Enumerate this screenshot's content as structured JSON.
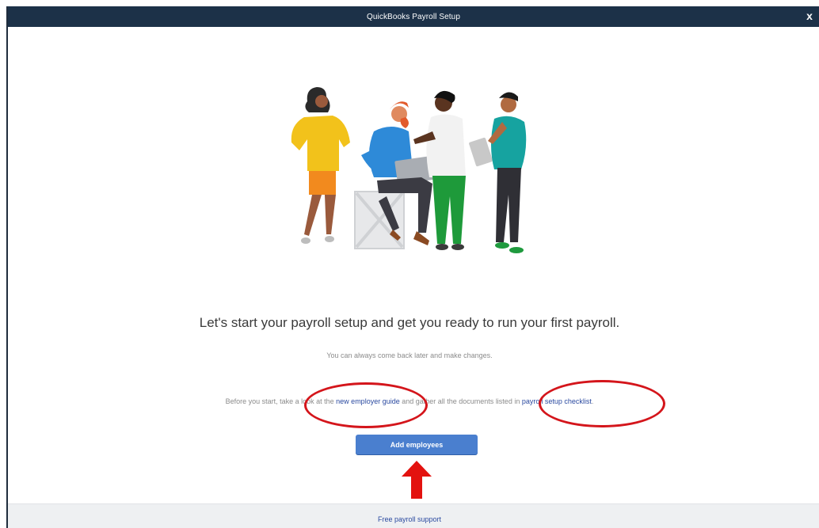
{
  "window": {
    "title": "QuickBooks Payroll Setup",
    "close_glyph": "x"
  },
  "main": {
    "heading": "Let's start your payroll setup and get you ready to run your first payroll.",
    "subheading": "You can always come back later and make changes.",
    "note": {
      "prefix": "Before you start, take a look at the ",
      "link1": "new employer guide",
      "middle": " and gather all the documents listed in ",
      "link2": "payroll setup checklist",
      "suffix": "."
    },
    "add_employees_label": "Add employees"
  },
  "footer": {
    "support_link": "Free payroll support"
  },
  "annotations": {
    "circle_color": "#d4151b",
    "arrow_color": "#e3120f"
  },
  "colors": {
    "titlebar": "#1c3148",
    "button": "#4a7fcf",
    "link": "#2b4aa0"
  }
}
